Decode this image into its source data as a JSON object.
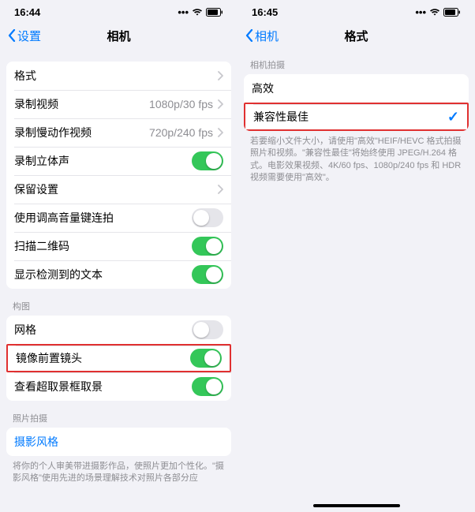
{
  "left": {
    "time": "16:44",
    "back_label": "设置",
    "title": "相机",
    "row_formats": "格式",
    "row_video": "录制视频",
    "row_video_val": "1080p/30 fps",
    "row_slomo": "录制慢动作视频",
    "row_slomo_val": "720p/240 fps",
    "row_stereo": "录制立体声",
    "row_preserve": "保留设置",
    "row_burst": "使用调高音量键连拍",
    "row_qr": "扫描二维码",
    "row_livetext": "显示检测到的文本",
    "section_composition": "构图",
    "row_grid": "网格",
    "row_mirror": "镜像前置镜头",
    "row_viewoutside": "查看超取景框取景",
    "section_capture": "照片拍摄",
    "row_styles": "摄影风格",
    "footer": "将你的个人审美带进摄影作品，使照片更加个性化。\"摄影风格\"使用先进的场景理解技术对照片各部分应"
  },
  "right": {
    "time": "16:45",
    "back_label": "相机",
    "title": "格式",
    "section_capture": "相机拍摄",
    "opt_high_efficiency": "高效",
    "opt_most_compatible": "兼容性最佳",
    "footer": "若要缩小文件大小，请使用\"高效\"HEIF/HEVC 格式拍摄照片和视频。\"兼容性最佳\"将始终使用 JPEG/H.264 格式。电影效果视频、4K/60 fps、1080p/240 fps 和 HDR 视频需要使用\"高效\"。"
  }
}
